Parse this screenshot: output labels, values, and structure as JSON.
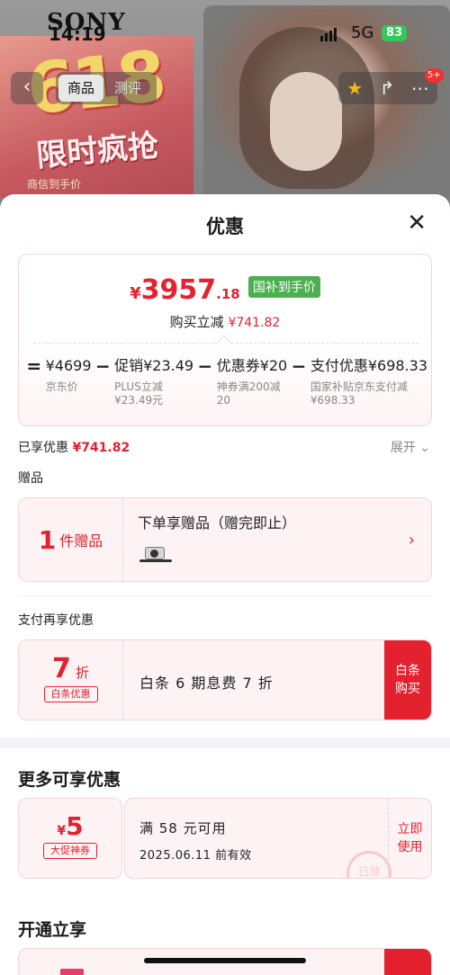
{
  "status_bar": {
    "brand": "SONY",
    "time": "14:19",
    "network": "5G",
    "battery": "83"
  },
  "background_page": {
    "tabs": [
      {
        "label": "商品",
        "active": true
      },
      {
        "label": "测评",
        "active": false
      }
    ],
    "cart_badge": "5+",
    "promo_number": "618",
    "promo_title": "限时疯抢",
    "promo_sub": "商信到手价"
  },
  "sheet": {
    "title": "优惠",
    "price": {
      "yen": "¥",
      "integer": "3957",
      "decimal": ".18",
      "tag": "国补到手价",
      "reduce_label": "购买立减",
      "reduce_amount": "¥741.82"
    },
    "breakdown": [
      {
        "op": "=",
        "value": "¥4699",
        "notes": [
          "京东价"
        ]
      },
      {
        "op": "−",
        "value": "促销¥23.49",
        "notes": [
          "PLUS立减",
          "¥23.49元"
        ]
      },
      {
        "op": "−",
        "value": "优惠券¥20",
        "notes": [
          "神券满200减",
          "20"
        ]
      },
      {
        "op": "−",
        "value": "支付优惠¥698.33",
        "notes": [
          "国家补贴京东支付减",
          "¥698.33"
        ]
      }
    ],
    "enjoyed_label": "已享优惠",
    "enjoyed_amount": "¥741.82",
    "expand_label": "展开",
    "gift_section": "赠品",
    "gift": {
      "count": "1",
      "unit": "件赠品",
      "title": "下单享赠品（赠完即止）"
    },
    "pay_section": "支付再享优惠",
    "pay": {
      "discount": "7",
      "unit": "折",
      "tag": "白条优惠",
      "text": "白条 6 期息费 7 折",
      "button": "白条\n购买"
    },
    "more_title": "更多可享优惠",
    "coupon": {
      "yen": "¥",
      "amount": "5",
      "tag": "大促神券",
      "condition": "满 58 元可用",
      "date": "2025.06.11 前有效",
      "button": "立即\n使用",
      "stamp": "已领"
    },
    "open_title": "开通立享"
  },
  "colors": {
    "accent": "#e4212f",
    "tag_green": "#4caf50",
    "card_bg": "#fdf3f4"
  }
}
